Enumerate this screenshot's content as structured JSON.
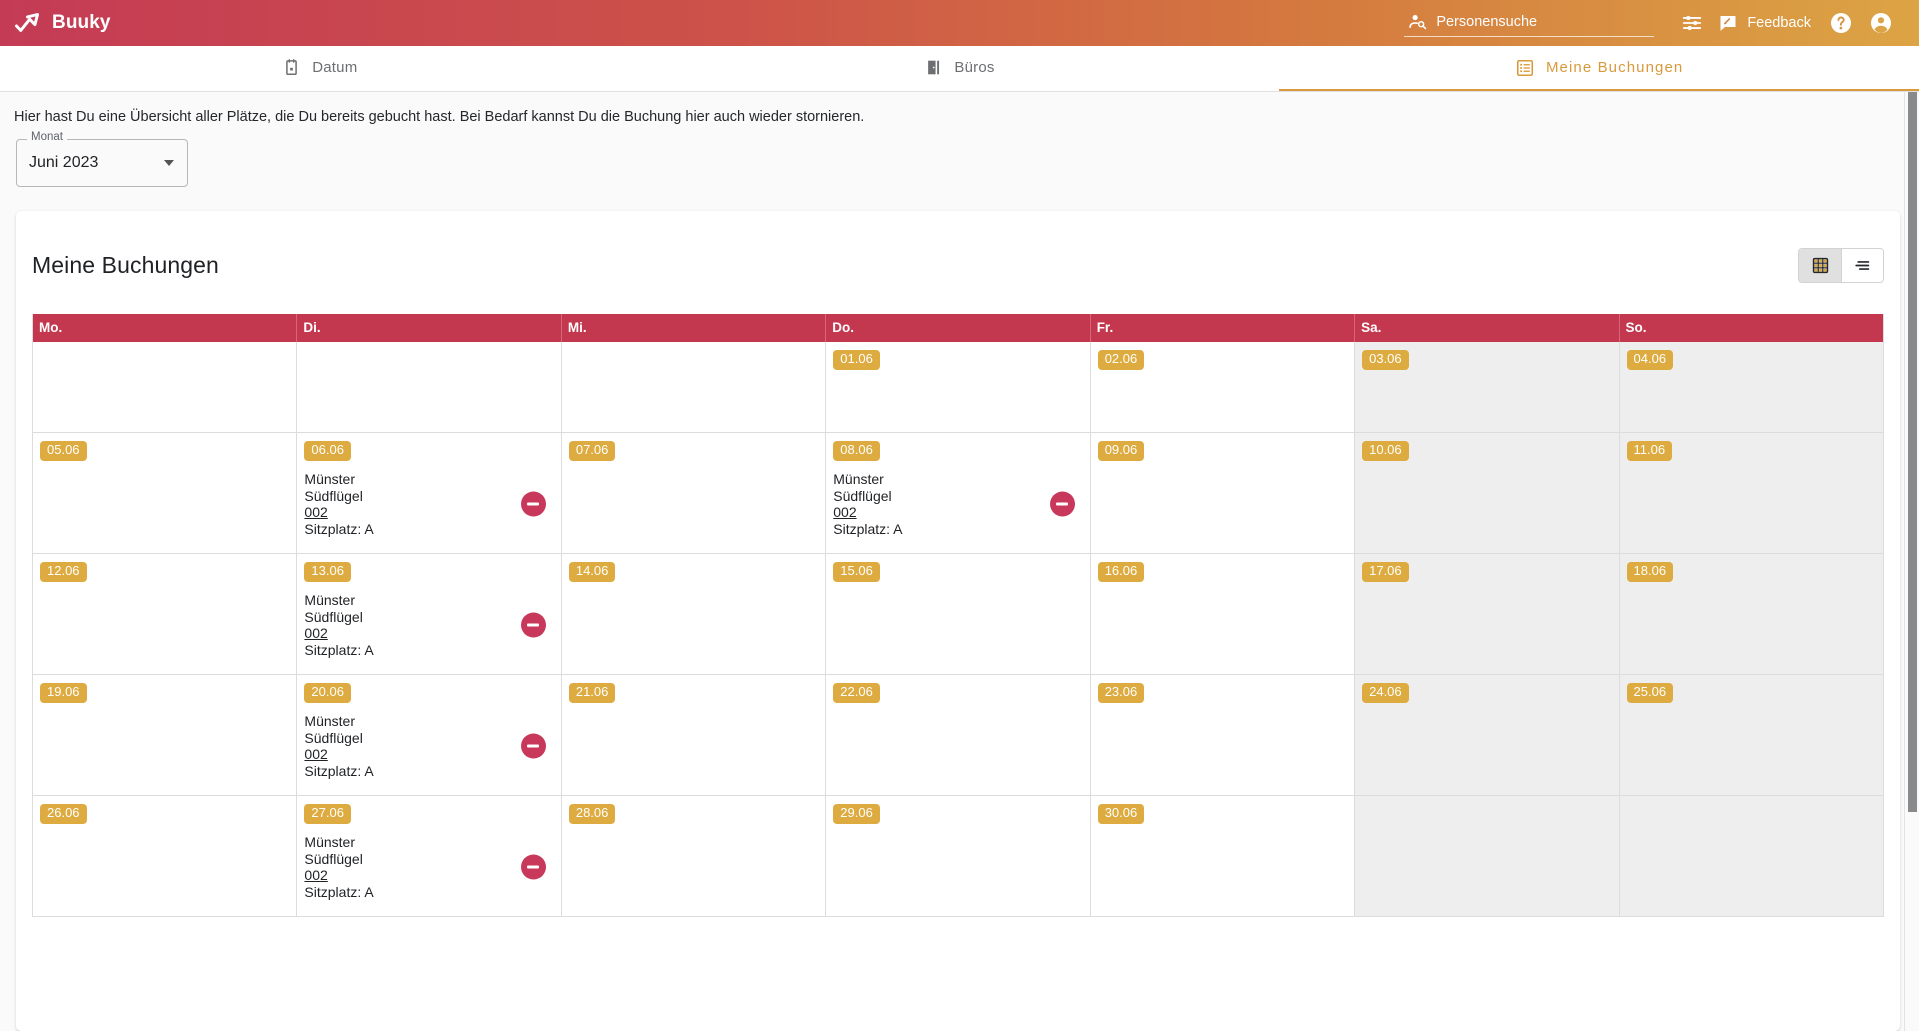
{
  "app": {
    "brand_name": "Buuky",
    "logo_icon": "check-trend-icon"
  },
  "header": {
    "search": {
      "icon": "person-search-icon",
      "placeholder": "Personensuche",
      "value": ""
    },
    "tune_icon": "tune-icon",
    "feedback": {
      "icon": "feedback-icon",
      "label": "Feedback"
    },
    "help_icon": "help-circle-icon",
    "account_icon": "account-circle-icon"
  },
  "tabs": [
    {
      "label": "Datum",
      "icon": "calendar-icon",
      "active": false
    },
    {
      "label": "Büros",
      "icon": "door-icon",
      "active": false
    },
    {
      "label": "Meine Buchungen",
      "icon": "list-icon",
      "active": true
    }
  ],
  "intro": {
    "text": "Hier hast Du eine Übersicht aller Plätze, die Du bereits gebucht hast. Bei Bedarf kannst Du die Buchung hier auch wieder stornieren."
  },
  "filter": {
    "month_select": {
      "legend": "Monat",
      "value": "Juni 2023",
      "options": [
        "Juni 2023"
      ]
    }
  },
  "card": {
    "title": "Meine Buchungen",
    "view_toggle": [
      {
        "name": "grid-view",
        "icon": "grid-icon",
        "selected": true
      },
      {
        "name": "list-view",
        "icon": "list-lines-icon",
        "selected": false
      }
    ]
  },
  "calendar": {
    "weekdays": [
      "Mo.",
      "Di.",
      "Mi.",
      "Do.",
      "Fr.",
      "Sa.",
      "So."
    ],
    "weeks": [
      [
        {
          "date": "",
          "weekend": false,
          "booking": null
        },
        {
          "date": "",
          "weekend": false,
          "booking": null
        },
        {
          "date": "",
          "weekend": false,
          "booking": null
        },
        {
          "date": "01.06",
          "weekend": false,
          "booking": null
        },
        {
          "date": "02.06",
          "weekend": false,
          "booking": null
        },
        {
          "date": "03.06",
          "weekend": true,
          "booking": null
        },
        {
          "date": "04.06",
          "weekend": true,
          "booking": null
        }
      ],
      [
        {
          "date": "05.06",
          "weekend": false,
          "booking": null
        },
        {
          "date": "06.06",
          "weekend": false,
          "booking": {
            "building": "Münster",
            "wing": "Südflügel",
            "room": "002",
            "seat": "Sitzplatz: A",
            "cancel_label": "Buchung stornieren"
          }
        },
        {
          "date": "07.06",
          "weekend": false,
          "booking": null
        },
        {
          "date": "08.06",
          "weekend": false,
          "booking": {
            "building": "Münster",
            "wing": "Südflügel",
            "room": "002",
            "seat": "Sitzplatz: A",
            "cancel_label": "Buchung stornieren"
          }
        },
        {
          "date": "09.06",
          "weekend": false,
          "booking": null
        },
        {
          "date": "10.06",
          "weekend": true,
          "booking": null
        },
        {
          "date": "11.06",
          "weekend": true,
          "booking": null
        }
      ],
      [
        {
          "date": "12.06",
          "weekend": false,
          "booking": null
        },
        {
          "date": "13.06",
          "weekend": false,
          "booking": {
            "building": "Münster",
            "wing": "Südflügel",
            "room": "002",
            "seat": "Sitzplatz: A",
            "cancel_label": "Buchung stornieren"
          }
        },
        {
          "date": "14.06",
          "weekend": false,
          "booking": null
        },
        {
          "date": "15.06",
          "weekend": false,
          "booking": null
        },
        {
          "date": "16.06",
          "weekend": false,
          "booking": null
        },
        {
          "date": "17.06",
          "weekend": true,
          "booking": null
        },
        {
          "date": "18.06",
          "weekend": true,
          "booking": null
        }
      ],
      [
        {
          "date": "19.06",
          "weekend": false,
          "booking": null
        },
        {
          "date": "20.06",
          "weekend": false,
          "booking": {
            "building": "Münster",
            "wing": "Südflügel",
            "room": "002",
            "seat": "Sitzplatz: A",
            "cancel_label": "Buchung stornieren"
          }
        },
        {
          "date": "21.06",
          "weekend": false,
          "booking": null
        },
        {
          "date": "22.06",
          "weekend": false,
          "booking": null
        },
        {
          "date": "23.06",
          "weekend": false,
          "booking": null
        },
        {
          "date": "24.06",
          "weekend": true,
          "booking": null
        },
        {
          "date": "25.06",
          "weekend": true,
          "booking": null
        }
      ],
      [
        {
          "date": "26.06",
          "weekend": false,
          "booking": null
        },
        {
          "date": "27.06",
          "weekend": false,
          "booking": {
            "building": "Münster",
            "wing": "Südflügel",
            "room": "002",
            "seat": "Sitzplatz: A",
            "cancel_label": "Buchung stornieren"
          }
        },
        {
          "date": "28.06",
          "weekend": false,
          "booking": null
        },
        {
          "date": "29.06",
          "weekend": false,
          "booking": null
        },
        {
          "date": "30.06",
          "weekend": false,
          "booking": null
        },
        {
          "date": "",
          "weekend": true,
          "booking": null
        },
        {
          "date": "",
          "weekend": true,
          "booking": null
        }
      ]
    ]
  },
  "colors": {
    "brand_gradient_start": "#c43b55",
    "brand_gradient_end": "#dca444",
    "calendar_header": "#c4384f",
    "date_badge": "#ddab3f",
    "cancel_button": "#c8385a",
    "active_tab": "#d99a3c",
    "weekend_cell": "#eeeeee"
  }
}
